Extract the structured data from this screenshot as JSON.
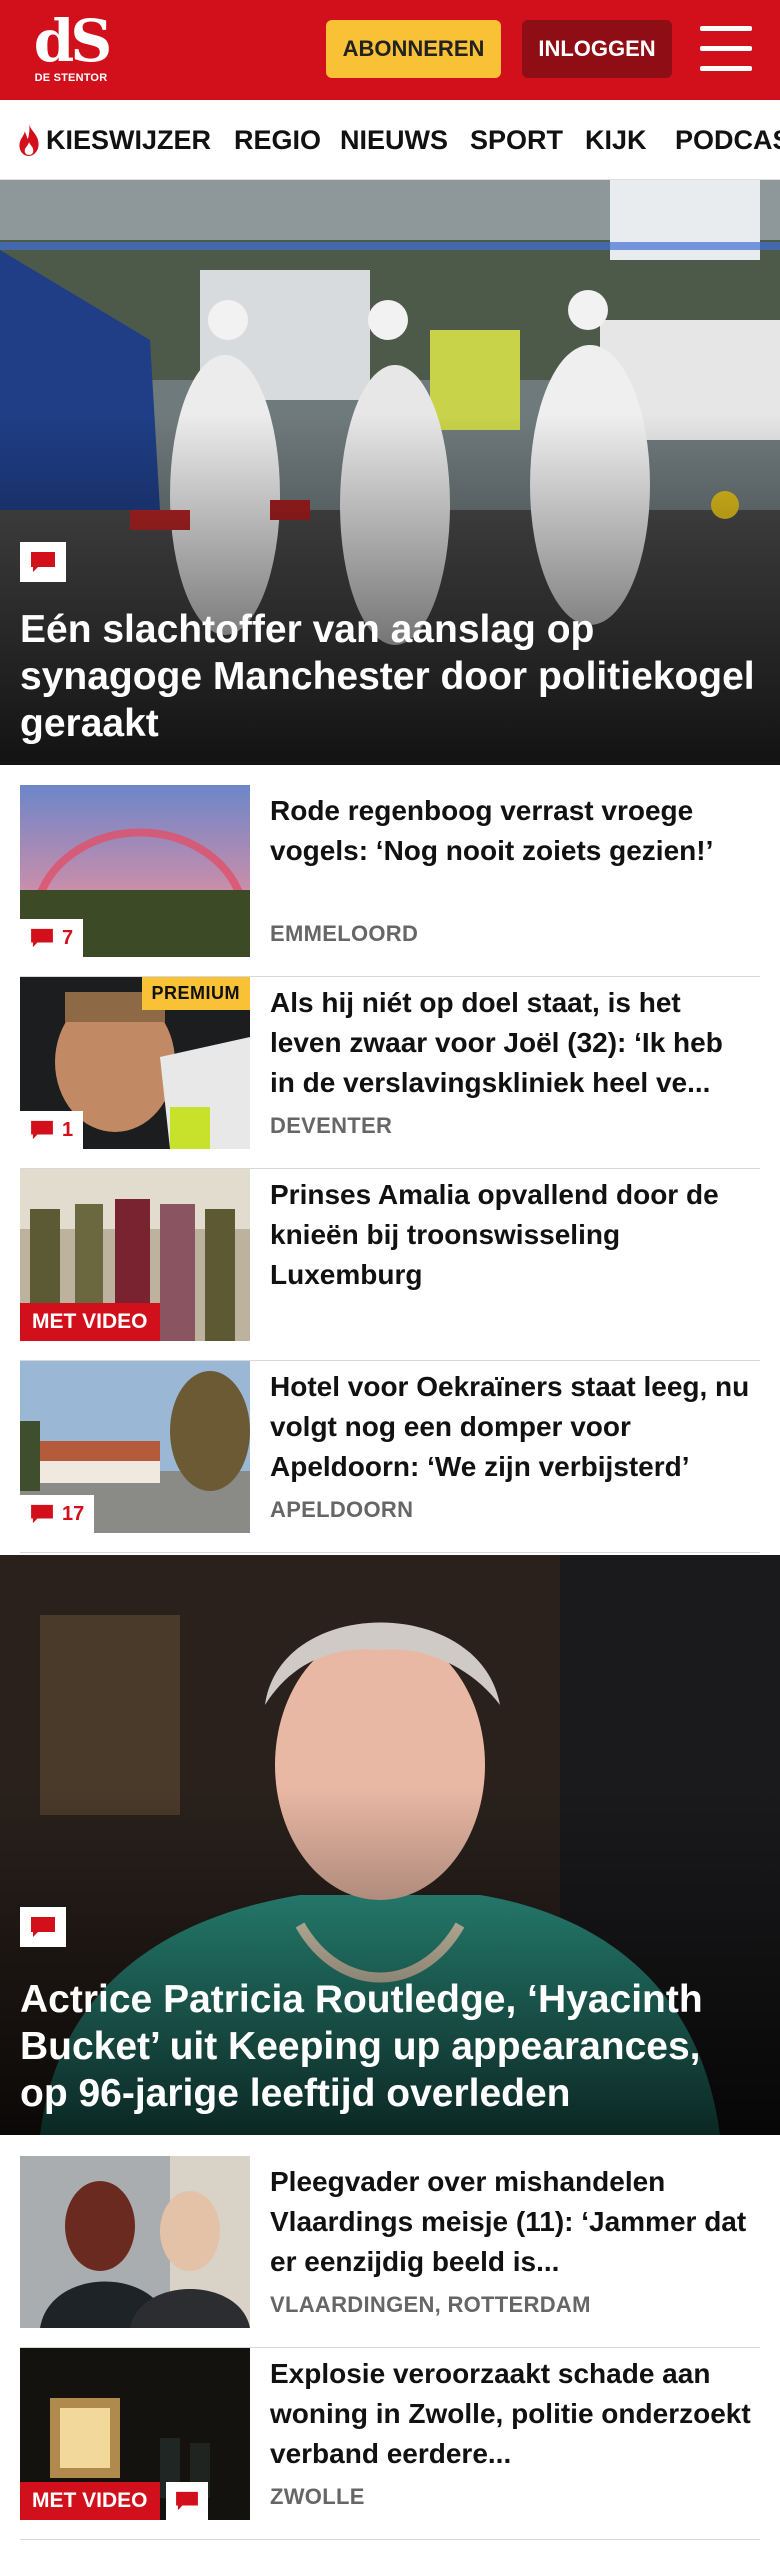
{
  "header": {
    "logo_mark": "dS",
    "logo_name": "DE STENTOR",
    "subscribe_label": "ABONNEREN",
    "login_label": "INLOGGEN"
  },
  "nav": {
    "items": [
      {
        "label": "KIESWIJZER",
        "icon": "flame-icon"
      },
      {
        "label": "REGIO"
      },
      {
        "label": "NIEUWS"
      },
      {
        "label": "SPORT"
      },
      {
        "label": "KIJK"
      },
      {
        "label": "PODCAST"
      }
    ]
  },
  "hero1": {
    "title": "Eén slachtoffer van aanslag op synagoge Manchester door politiekogel geraakt",
    "icon": "comment-icon"
  },
  "articles1": [
    {
      "title": "Rode regenboog verrast vroege vogels: ‘Nog nooit zoiets gezien!’",
      "place": "EMMELOORD",
      "comments": "7"
    },
    {
      "title": "Als hij niét op doel staat, is het leven zwaar voor Joël (32): ‘Ik heb in de verslavingskliniek heel ve...",
      "place": "DEVENTER",
      "comments": "1",
      "badge": "PREMIUM"
    },
    {
      "title": "Prinses Amalia opvallend door de knieën bij troonswisseling Luxemburg",
      "place": "",
      "video": "MET VIDEO"
    },
    {
      "title": "Hotel voor Oekraïners staat leeg, nu volgt nog een domper voor Apeldoorn: ‘We zijn verbijsterd’",
      "place": "APELDOORN",
      "comments": "17"
    }
  ],
  "hero2": {
    "title": "Actrice Patricia Routledge, ‘Hyacinth Bucket’ uit Keeping up appearances, op 96-jarige leeftijd overleden",
    "icon": "comment-icon"
  },
  "articles2": [
    {
      "title": "Pleegvader over mishandelen Vlaardings meisje (11): ‘Jammer dat er eenzijdig beeld is...",
      "place": "VLAARDINGEN, ROTTERDAM"
    },
    {
      "title": "Explosie veroorzaakt schade aan woning in Zwolle, politie onderzoekt verband eerdere...",
      "place": "ZWOLLE",
      "video": "MET VIDEO"
    }
  ],
  "colors": {
    "brand": "#d1101c",
    "accent": "#f9c136",
    "login": "#8f0d14"
  }
}
